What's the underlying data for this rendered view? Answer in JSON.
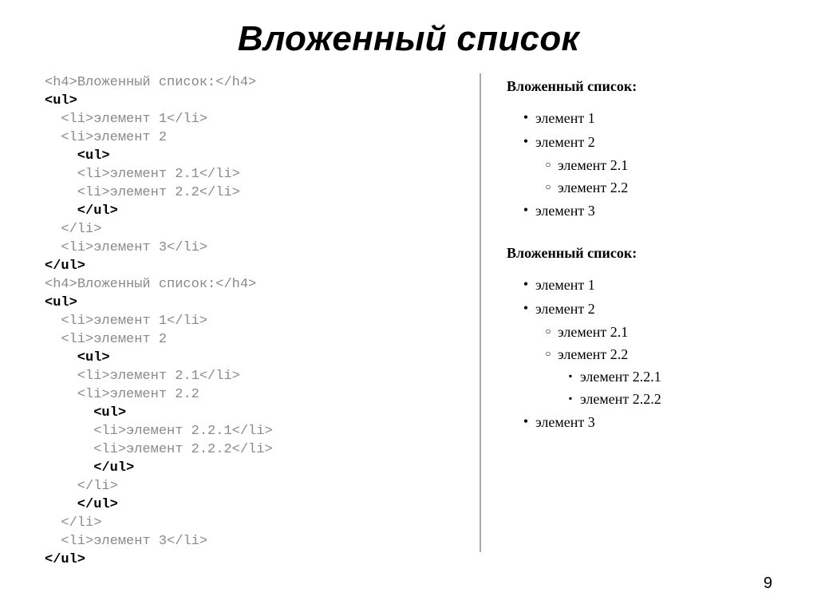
{
  "title": "Вложенный список",
  "page_number": "9",
  "code": {
    "l01a": "<h4>",
    "l01b": "Вложенный список:",
    "l01c": "</h4>",
    "l02": "<ul>",
    "l03a": "  <li>",
    "l03b": "элемент 1",
    "l03c": "</li>",
    "l04a": "  <li>",
    "l04b": "элемент 2",
    "l05": "    <ul>",
    "l06a": "    <li>",
    "l06b": "элемент 2.1",
    "l06c": "</li>",
    "l07a": "    <li>",
    "l07b": "элемент 2.2",
    "l07c": "</li>",
    "l08": "    </ul>",
    "l09": "  </li>",
    "l10a": "  <li>",
    "l10b": "элемент 3",
    "l10c": "</li>",
    "l11": "</ul>",
    "l12a": "<h4>",
    "l12b": "Вложенный список:",
    "l12c": "</h4>",
    "l13": "<ul>",
    "l14a": "  <li>",
    "l14b": "элемент 1",
    "l14c": "</li>",
    "l15a": "  <li>",
    "l15b": "элемент 2",
    "l16": "    <ul>",
    "l17a": "    <li>",
    "l17b": "элемент 2.1",
    "l17c": "</li>",
    "l18a": "    <li>",
    "l18b": "элемент 2.2",
    "l19": "      <ul>",
    "l20a": "      <li>",
    "l20b": "элемент 2.2.1",
    "l20c": "</li>",
    "l21a": "      <li>",
    "l21b": "элемент 2.2.2",
    "l21c": "</li>",
    "l22": "      </ul>",
    "l23": "    </li>",
    "l24": "    </ul>",
    "l25": "  </li>",
    "l26a": "  <li>",
    "l26b": "элемент 3",
    "l26c": "</li>",
    "l27": "</ul>"
  },
  "render": {
    "h1": "Вложенный список:",
    "list1": {
      "i1": "элемент 1",
      "i2": "элемент 2",
      "i21": "элемент 2.1",
      "i22": "элемент 2.2",
      "i3": "элемент 3"
    },
    "h2": "Вложенный список:",
    "list2": {
      "i1": "элемент 1",
      "i2": "элемент 2",
      "i21": "элемент 2.1",
      "i22": "элемент 2.2",
      "i221": "элемент 2.2.1",
      "i222": "элемент 2.2.2",
      "i3": "элемент 3"
    }
  }
}
